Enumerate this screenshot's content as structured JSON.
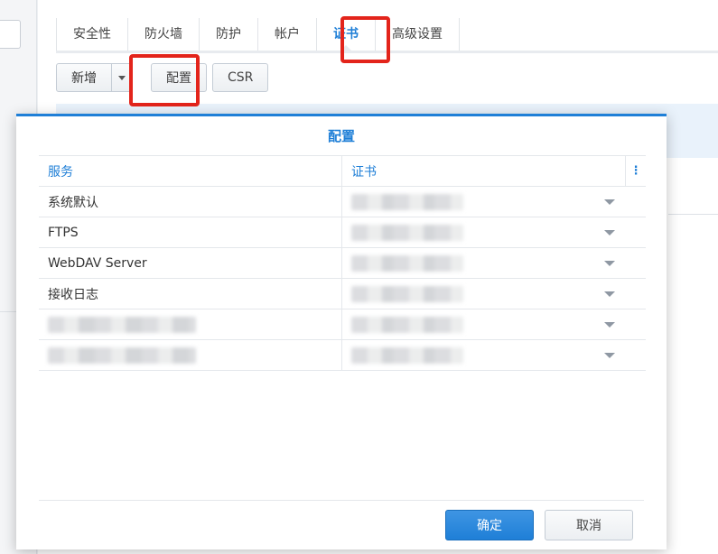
{
  "window": {
    "title": ""
  },
  "tabs": [
    {
      "label": "安全性"
    },
    {
      "label": "防火墙"
    },
    {
      "label": "防护"
    },
    {
      "label": "帐户"
    },
    {
      "label": "证书"
    },
    {
      "label": "高级设置"
    }
  ],
  "active_tab": "证书",
  "toolbar": {
    "add_label": "新增",
    "configure_label": "配置",
    "csr_label": "CSR"
  },
  "dialog": {
    "title": "配置",
    "columns": {
      "service": "服务",
      "certificate": "证书"
    },
    "rows": [
      {
        "service": "系统默认"
      },
      {
        "service": "FTPS"
      },
      {
        "service": "WebDAV Server"
      },
      {
        "service": "接收日志"
      },
      {
        "service": ""
      },
      {
        "service": ""
      }
    ],
    "ok_label": "确定",
    "cancel_label": "取消"
  },
  "colors": {
    "accent": "#1f7fd7",
    "highlight": "#e3241b"
  }
}
